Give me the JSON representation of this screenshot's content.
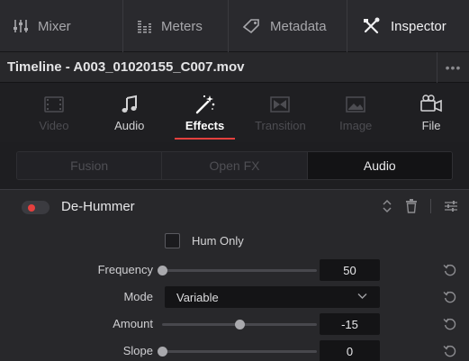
{
  "toolbar": {
    "mixer_label": "Mixer",
    "meters_label": "Meters",
    "metadata_label": "Metadata",
    "inspector_label": "Inspector"
  },
  "titlebar": {
    "title": "Timeline - A003_01020155_C007.mov",
    "more_label": "•••"
  },
  "category_tabs": [
    {
      "label": "Video",
      "icon": "video-frame-icon",
      "enabled": false
    },
    {
      "label": "Audio",
      "icon": "music-note-icon",
      "enabled": true
    },
    {
      "label": "Effects",
      "icon": "magic-wand-icon",
      "enabled": true,
      "active": true
    },
    {
      "label": "Transition",
      "icon": "transition-icon",
      "enabled": false
    },
    {
      "label": "Image",
      "icon": "image-icon",
      "enabled": false
    },
    {
      "label": "File",
      "icon": "file-camera-icon",
      "enabled": true
    }
  ],
  "sub_tabs": [
    {
      "label": "Fusion",
      "enabled": false
    },
    {
      "label": "Open FX",
      "enabled": false
    },
    {
      "label": "Audio",
      "active": true
    }
  ],
  "effect": {
    "name": "De-Hummer",
    "enabled": true,
    "hum_only_label": "Hum Only",
    "hum_only_checked": false,
    "params": {
      "frequency": {
        "label": "Frequency",
        "value": "50",
        "slider_fraction": 0.0
      },
      "mode": {
        "label": "Mode",
        "value": "Variable"
      },
      "amount": {
        "label": "Amount",
        "value": "-15",
        "slider_fraction": 0.5
      },
      "slope": {
        "label": "Slope",
        "value": "0",
        "slider_fraction": 0.0
      }
    }
  },
  "colors": {
    "accent_red": "#e5403e",
    "panel_bg": "#28282b"
  }
}
